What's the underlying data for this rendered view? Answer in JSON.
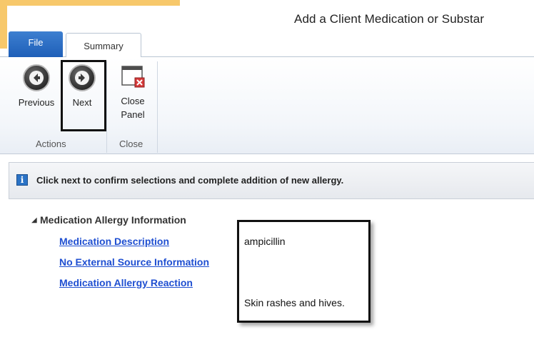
{
  "window": {
    "title": "Add a Client Medication or Substar"
  },
  "tabs": [
    {
      "label": "File"
    },
    {
      "label": "Summary"
    }
  ],
  "ribbon": {
    "buttons": {
      "previous": {
        "label": "Previous",
        "icon": "arrow-left-icon"
      },
      "next": {
        "label": "Next",
        "icon": "arrow-right-icon"
      },
      "close_panel": {
        "label": "Close Panel",
        "label_line1": "Close",
        "label_line2": "Panel",
        "icon": "close-panel-icon"
      }
    },
    "groups": {
      "actions": "Actions",
      "close": "Close"
    }
  },
  "info_bar": {
    "icon": "info-icon",
    "message": "Click next to confirm selections and complete addition of new allergy."
  },
  "section": {
    "title": "Medication Allergy Information",
    "rows": [
      {
        "label": "Medication Description",
        "value": "ampicillin"
      },
      {
        "label": "No External Source Information",
        "value": ""
      },
      {
        "label": "Medication Allergy Reaction",
        "value": "Skin rashes and hives."
      }
    ]
  },
  "colors": {
    "accent": "#f7c86b",
    "file_tab": "#1e5fb8",
    "link": "#1f4fd1",
    "info_icon": "#2b73c6"
  }
}
